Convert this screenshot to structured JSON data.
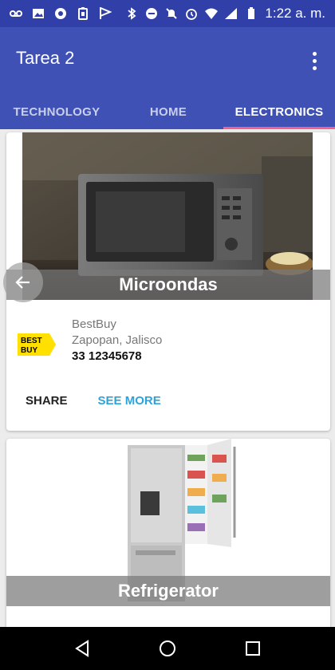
{
  "status_bar": {
    "time": "1:22 a. m."
  },
  "app_bar": {
    "title": "Tarea 2"
  },
  "tabs": [
    {
      "label": "TECHNOLOGY",
      "active": false
    },
    {
      "label": "HOME",
      "active": false
    },
    {
      "label": "ELECTRONICS",
      "active": true
    }
  ],
  "cards": [
    {
      "caption": "Microondas",
      "image_icon": "microwave-photo",
      "store": {
        "logo": "bestbuy-logo",
        "logo_text": "BEST BUY",
        "name": "BestBuy",
        "location": "Zapopan, Jalisco",
        "phone": "33 12345678"
      },
      "actions": {
        "share": "SHARE",
        "see_more": "SEE MORE"
      }
    },
    {
      "caption": "Refrigerator",
      "image_icon": "refrigerator-photo"
    }
  ],
  "colors": {
    "primary": "#3f51b5",
    "status_bar": "#3040a8",
    "tab_indicator": "#f06292",
    "accent_link": "#2ea3d8"
  }
}
